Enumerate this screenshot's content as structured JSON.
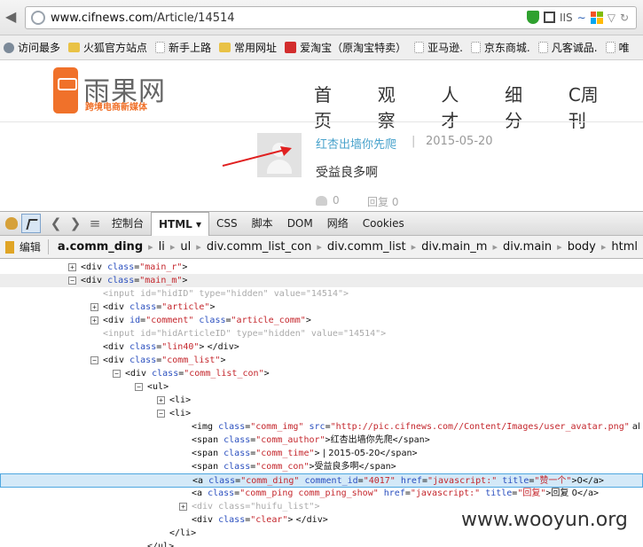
{
  "browser": {
    "url_host": "www.cifnews.com",
    "url_path": "/Article/14514",
    "addon_label": "IIS",
    "bookmarks": [
      {
        "label": "访问最多",
        "icon": "gear-icon"
      },
      {
        "label": "火狐官方站点",
        "icon": "folder-icon"
      },
      {
        "label": "新手上路",
        "icon": "page-icon"
      },
      {
        "label": "常用网址",
        "icon": "folder-icon"
      },
      {
        "label": "爱淘宝（原淘宝特卖）",
        "icon": "taobao-icon"
      },
      {
        "label": "亚马逊.",
        "icon": "page-icon"
      },
      {
        "label": "京东商城.",
        "icon": "page-icon"
      },
      {
        "label": "凡客诚品.",
        "icon": "page-icon"
      },
      {
        "label": "唯",
        "icon": "page-icon"
      }
    ]
  },
  "site": {
    "logo_name": "雨果网",
    "logo_sub": "跨境电商新媒体",
    "nav": [
      "首页",
      "观察",
      "人才",
      "细分",
      "C周刊"
    ],
    "comment": {
      "author": "红杏出墙你先爬",
      "separator": "|",
      "time": "2015-05-20",
      "content": "受益良多啊",
      "ding": "0",
      "ping": "回复 0"
    }
  },
  "firebug": {
    "tabs": [
      "控制台",
      "HTML ▾",
      "CSS",
      "脚本",
      "DOM",
      "网络",
      "Cookies"
    ],
    "active_tab": "HTML ▾",
    "edit_label": "编辑",
    "breadcrumb": [
      "a.comm_ding",
      "li",
      "ul",
      "div.comm_list_con",
      "div.comm_list",
      "div.main_m",
      "div.main",
      "body",
      "html"
    ],
    "tree": [
      {
        "text": "<div class=\"main_r\">"
      },
      {
        "text": "<div class=\"main_m\">"
      },
      {
        "text": "<input id=\"hidID\" type=\"hidden\" value=\"14514\">"
      },
      {
        "text": "<div class=\"article\">"
      },
      {
        "text": "<div id=\"comment\" class=\"article_comm\">"
      },
      {
        "text": "<input id=\"hidArticleID\" type=\"hidden\" value=\"14514\">"
      },
      {
        "text": "<div class=\"lin40\">  </div>"
      },
      {
        "text": "<div class=\"comm_list\">"
      },
      {
        "text": "<div class=\"comm_list_con\">"
      },
      {
        "text": "<ul>"
      },
      {
        "text": "<li>"
      },
      {
        "text": "<li>"
      },
      {
        "text": "<img class=\"comm_img\" src=\"http://pic.cifnews.com//Content/Images/user_avatar.png\" al"
      },
      {
        "text": "<span class=\"comm_author\">红杏出墙你先爬</span>"
      },
      {
        "text": "<span class=\"comm_time\">    |    2015-05-20</span>"
      },
      {
        "text": "<span class=\"comm_con\">受益良多啊</span>"
      },
      {
        "text": "<a class=\"comm_ding\" comment_id=\"4017\" href=\"javascript:\" title=\"赞一个\">0</a>"
      },
      {
        "text": "<a class=\"comm_ping comm_ping_show\" href=\"javascript:\" title=\"回复\">回复 0</a>"
      },
      {
        "text": "<div class=\"huifu_list\">"
      },
      {
        "text": "<div class=\"clear\">  </div>"
      },
      {
        "text": "</li>"
      },
      {
        "text": "</ul>"
      }
    ]
  },
  "watermark": "www.wooyun.org",
  "colors": {
    "accent_orange": "#f0712a",
    "author_blue": "#4aa3cc",
    "attr_name": "#2a4fbf",
    "attr_value": "#c4262c",
    "arrow_red": "#e02020"
  }
}
